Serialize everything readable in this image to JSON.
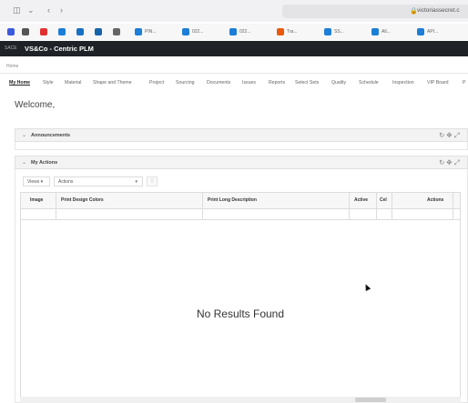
{
  "browser": {
    "url": "victoriassecret.c",
    "bookmarks": [
      {
        "label": "",
        "color": "#3b5bdb"
      },
      {
        "label": "",
        "color": "#555555"
      },
      {
        "label": "",
        "color": "#e03131"
      },
      {
        "label": "",
        "color": "#1c7ed6"
      },
      {
        "label": "",
        "color": "#1971c2"
      },
      {
        "label": "",
        "color": "#1864ab"
      },
      {
        "label": "",
        "color": "#666666"
      },
      {
        "label": "PIN...",
        "color": "#1c7ed6"
      },
      {
        "label": "022...",
        "color": "#1c7ed6"
      },
      {
        "label": "022...",
        "color": "#1c7ed6"
      },
      {
        "label": "Tra...",
        "color": "#e8590c"
      },
      {
        "label": "SS...",
        "color": "#1c7ed6"
      },
      {
        "label": "All...",
        "color": "#1c7ed6"
      },
      {
        "label": "API...",
        "color": "#1c7ed6"
      }
    ]
  },
  "app": {
    "prefix": "SACE",
    "title": "VS&Co - Centric PLM"
  },
  "breadcrumb": "Home",
  "nav": {
    "tabs": [
      "My Home",
      "Style",
      "Material",
      "Shape and Theme",
      "Project",
      "Sourcing",
      "Documents",
      "Issues",
      "Reports",
      "Select Sets",
      "Quality",
      "Schedule",
      "Inspection",
      "VIP Board",
      "P"
    ]
  },
  "welcome": "Welcome,",
  "announcements": {
    "title": "Announcements"
  },
  "my_actions": {
    "title": "My Actions",
    "views_label": "Views",
    "actions_label": "Actions",
    "columns": [
      "Image",
      "Print Design Colors",
      "Print Long Description",
      "Active",
      "Cel",
      "Actions"
    ],
    "empty_text": "No Results Found"
  },
  "colors": {
    "app_header": "#1f2327"
  }
}
